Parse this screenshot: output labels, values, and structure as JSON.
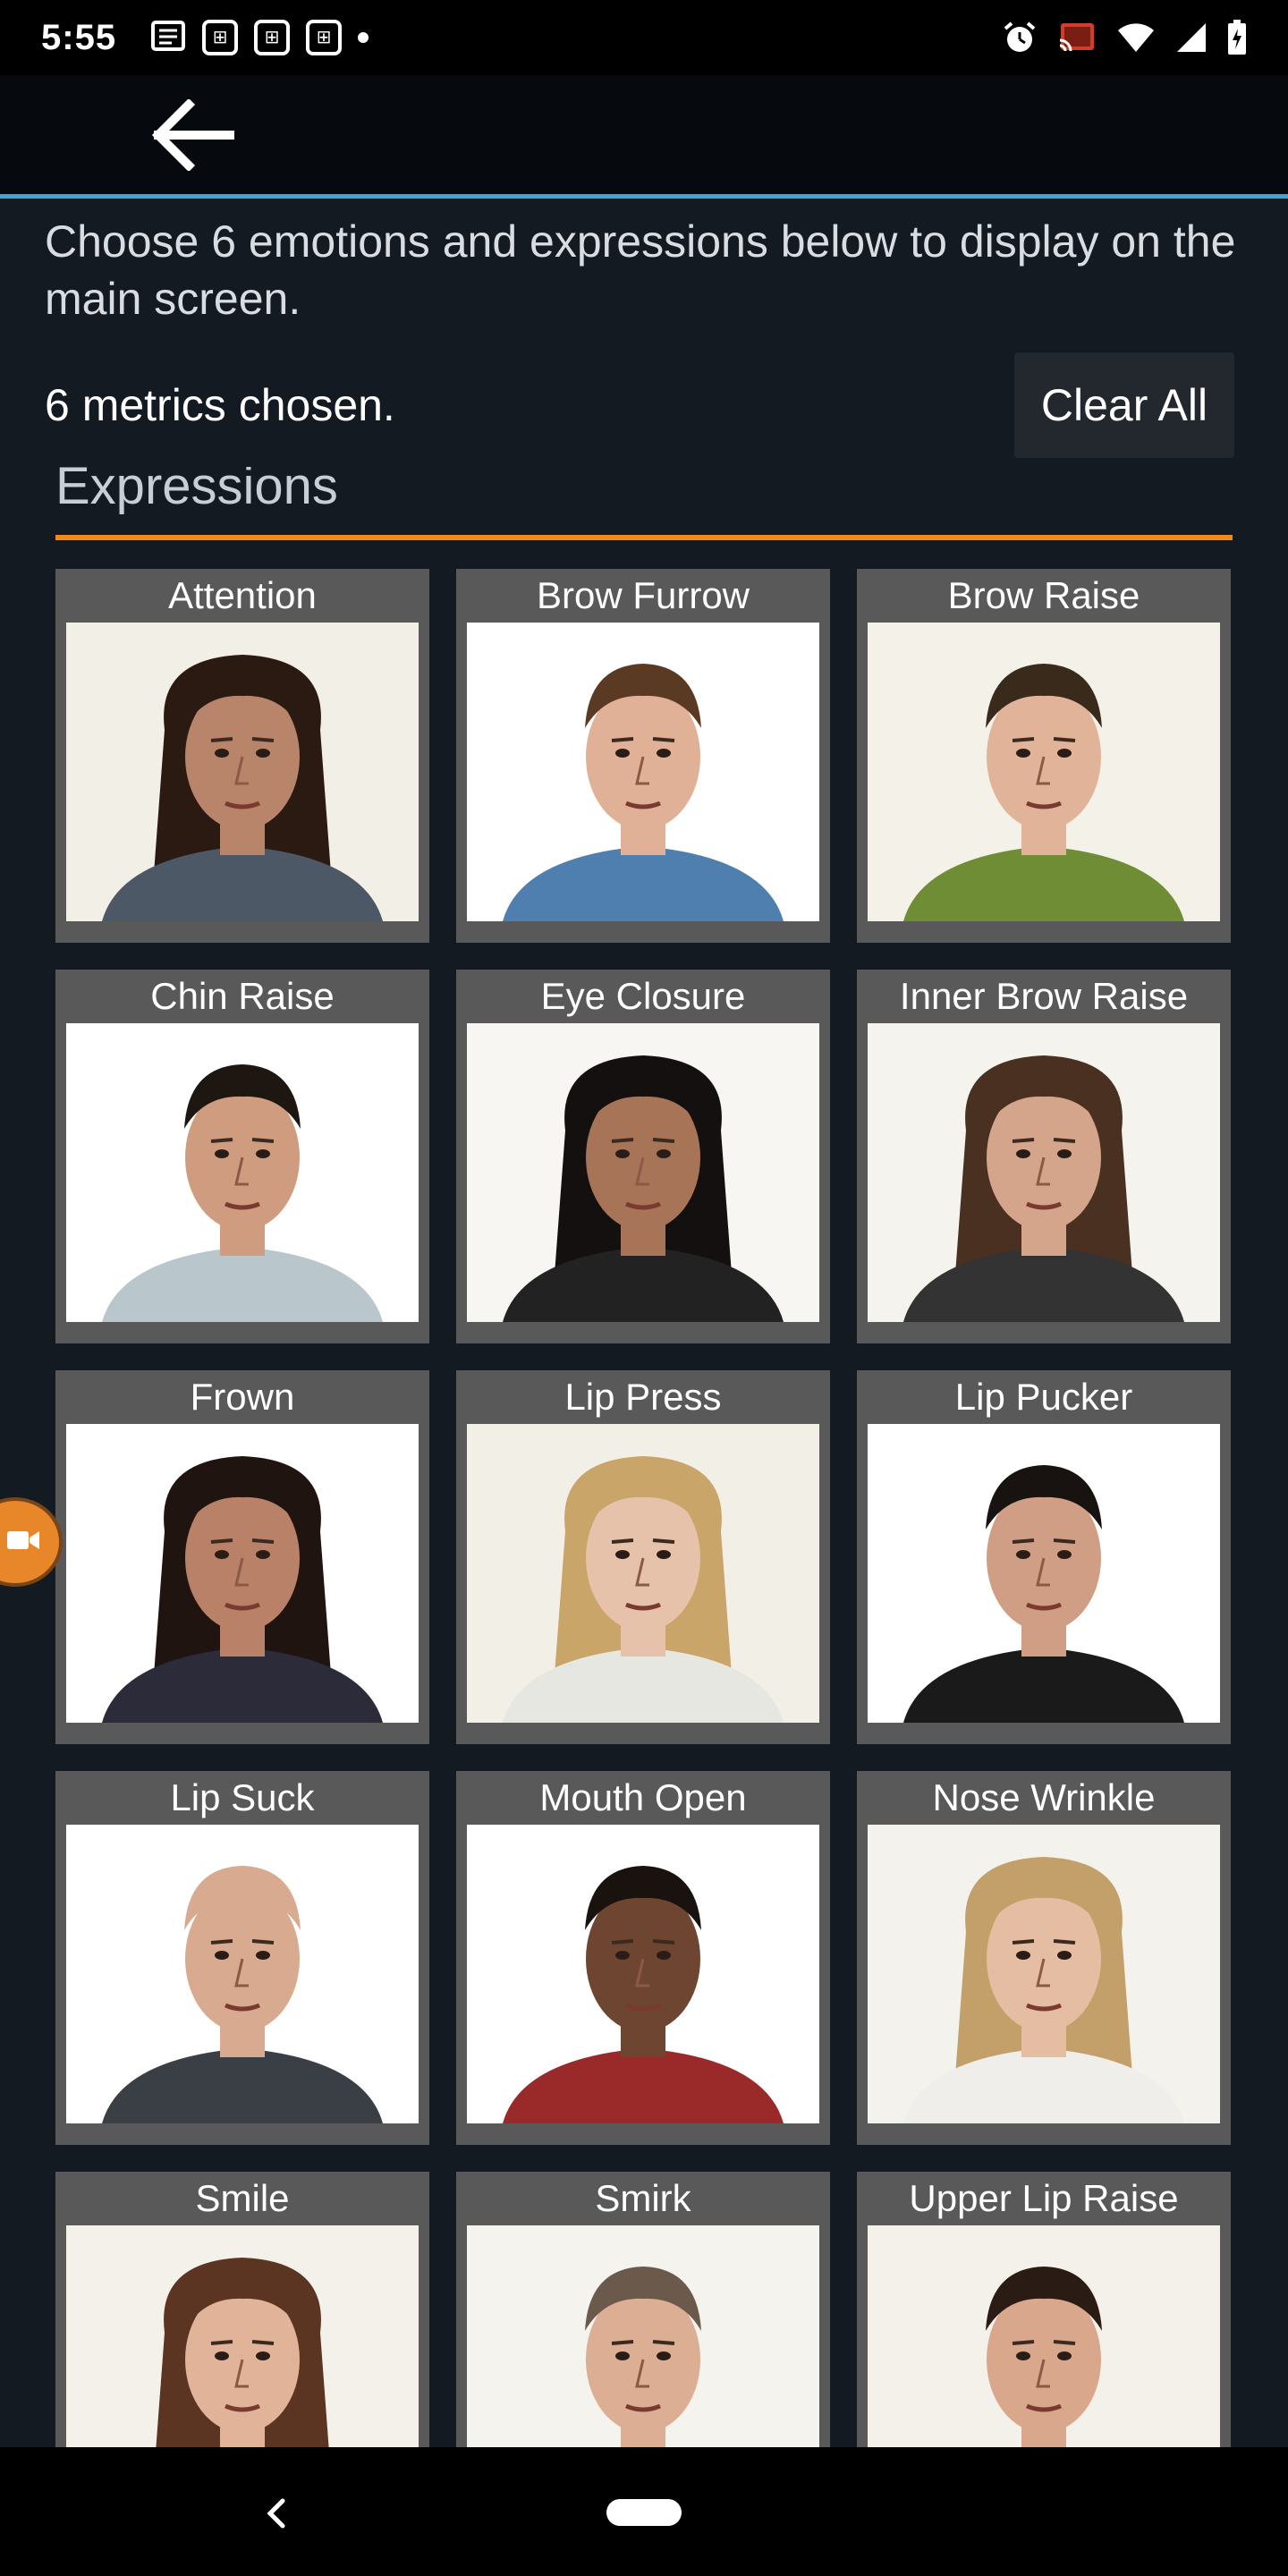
{
  "status_bar": {
    "time": "5:55",
    "notification_icons": [
      "news-icon",
      "calculator-icon",
      "calculator-icon",
      "calculator-icon",
      "more-dot-icon"
    ],
    "system_icons": [
      "alarm-icon",
      "cast-icon",
      "wifi-icon",
      "signal-icon",
      "battery-charging-icon"
    ]
  },
  "app_bar": {
    "back_icon": "arrow-left-icon",
    "accent_color": "#3ea6d3"
  },
  "instruction": "Choose 6 emotions and expressions below to display on the main screen.",
  "metrics": {
    "count_text": "6 metrics chosen.",
    "clear_label": "Clear All"
  },
  "section": {
    "title": "Expressions",
    "accent_color": "#f08a1c"
  },
  "expressions": [
    {
      "label": "Attention",
      "photo": {
        "bg": "#f2efe6",
        "skin": "#b8856a",
        "hair": "#2a1a12",
        "shirt": "#4d5866",
        "long_hair": true
      }
    },
    {
      "label": "Brow Furrow",
      "photo": {
        "bg": "#ffffff",
        "skin": "#e0b097",
        "hair": "#5a3a22",
        "shirt": "#4f7fae",
        "long_hair": false
      }
    },
    {
      "label": "Brow Raise",
      "photo": {
        "bg": "#f3f1e8",
        "skin": "#e1b49a",
        "hair": "#3a2a1c",
        "shirt": "#6f8d34",
        "long_hair": false
      }
    },
    {
      "label": "Chin Raise",
      "photo": {
        "bg": "#ffffff",
        "skin": "#cf9c7f",
        "hair": "#1e1611",
        "shirt": "#b9c6cc",
        "long_hair": false
      }
    },
    {
      "label": "Eye Closure",
      "photo": {
        "bg": "#f7f6f2",
        "skin": "#a87458",
        "hair": "#151010",
        "shirt": "#222222",
        "long_hair": true
      }
    },
    {
      "label": "Inner Brow Raise",
      "photo": {
        "bg": "#f5f3ee",
        "skin": "#d5a58b",
        "hair": "#4a3020",
        "shirt": "#333333",
        "long_hair": true
      }
    },
    {
      "label": "Frown",
      "photo": {
        "bg": "#ffffff",
        "skin": "#b98268",
        "hair": "#201410",
        "shirt": "#2b2b3a",
        "long_hair": true
      }
    },
    {
      "label": "Lip Press",
      "photo": {
        "bg": "#f1efe6",
        "skin": "#e6c2aa",
        "hair": "#c9a56a",
        "shirt": "#e7e7e2",
        "long_hair": true
      }
    },
    {
      "label": "Lip Pucker",
      "photo": {
        "bg": "#ffffff",
        "skin": "#cf9e84",
        "hair": "#181210",
        "shirt": "#1a1a1a",
        "long_hair": false
      }
    },
    {
      "label": "Lip Suck",
      "photo": {
        "bg": "#ffffff",
        "skin": "#d8aa8f",
        "hair": "#d8aa8f",
        "shirt": "#3a3f45",
        "long_hair": false
      }
    },
    {
      "label": "Mouth Open",
      "photo": {
        "bg": "#ffffff",
        "skin": "#6e4530",
        "hair": "#1a120e",
        "shirt": "#9a2a2a",
        "long_hair": false
      }
    },
    {
      "label": "Nose Wrinkle",
      "photo": {
        "bg": "#f4f2ec",
        "skin": "#e4bda3",
        "hair": "#c3a06a",
        "shirt": "#efeeea",
        "long_hair": true
      }
    },
    {
      "label": "Smile",
      "photo": {
        "bg": "#f4f1ea",
        "skin": "#e1b49a",
        "hair": "#5b3522",
        "shirt": "#c84a3a",
        "long_hair": true
      }
    },
    {
      "label": "Smirk",
      "photo": {
        "bg": "#f5f3ee",
        "skin": "#dcae94",
        "hair": "#6b5a4c",
        "shirt": "#3a3a3a",
        "long_hair": false
      }
    },
    {
      "label": "Upper Lip Raise",
      "photo": {
        "bg": "#f3f1ea",
        "skin": "#d9a78c",
        "hair": "#2a1c14",
        "shirt": "#444444",
        "long_hair": false
      }
    }
  ],
  "floating_button": {
    "icon": "video-camera-icon",
    "color": "#e8862a"
  },
  "nav_bar": {
    "back_icon": "nav-back-icon",
    "home_icon": "home-pill-icon"
  }
}
